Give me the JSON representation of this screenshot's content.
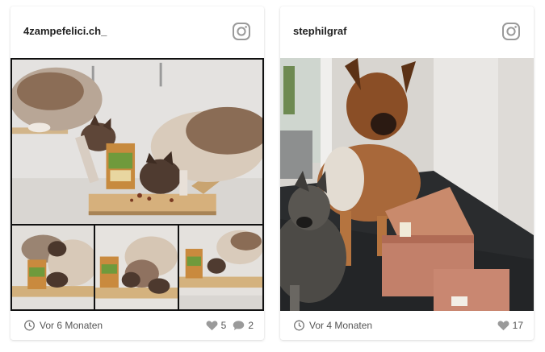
{
  "posts": [
    {
      "username": "4zampefelici.ch_",
      "time_ago": "Vor 6 Monaten",
      "likes": "5",
      "comments": "2",
      "social_icon": "instagram-icon"
    },
    {
      "username": "stephilgraf",
      "time_ago": "Vor 4 Monaten",
      "likes": "17",
      "social_icon": "instagram-icon"
    }
  ],
  "colors": {
    "icon_gray": "#9a9a9a",
    "username": "#222222",
    "meta_text": "#555555"
  }
}
